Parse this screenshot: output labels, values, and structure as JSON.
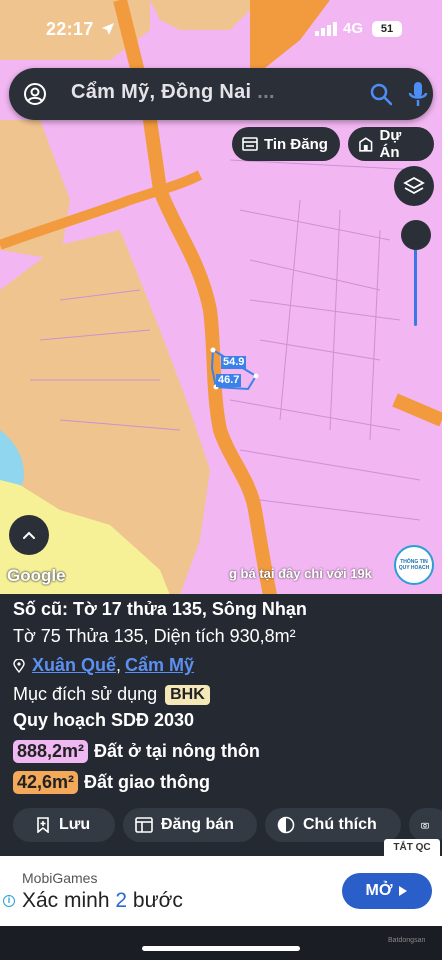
{
  "status": {
    "time": "22:17",
    "network": "4G",
    "battery": "51"
  },
  "search": {
    "text_main": "Cẩm Mỹ, Đồng Nai",
    "text_faded": "..."
  },
  "chips": {
    "tin_dang": "Tin Đăng",
    "du_an": "Dự Án"
  },
  "map": {
    "parcel_label_1": "54.9",
    "parcel_label_2": "46.7",
    "google": "Google",
    "marquee": "g bá tại đây chỉ với 19k",
    "info_badge_line1": "THÔNG TIN",
    "info_badge_line2": "QUY HOẠCH",
    "colors": {
      "residential": "#f2b6f2",
      "agriculture": "#f0c48e",
      "road": "#f29a3e",
      "water": "#8fd6ee",
      "yellow": "#f6f197"
    }
  },
  "sheet": {
    "old_id": "Số cũ: Tờ 17 thửa 135, Sông Nhạn",
    "new_id": "Tờ 75 Thửa 135, Diện tích 930,8m²",
    "commune": "Xuân Quế",
    "district": "Cẩm Mỹ",
    "purpose_label": "Mục đích sử dụng",
    "purpose_code": "BHK",
    "plan_title": "Quy hoạch SDĐ 2030",
    "zones": [
      {
        "area": "888,2m²",
        "label": "Đất ở tại nông thôn",
        "color": "#f0b8f2"
      },
      {
        "area": "42,6m²",
        "label": "Đất giao thông",
        "color": "#f4a85a"
      }
    ]
  },
  "actions": {
    "luu": "Lưu",
    "dang_ban": "Đăng bán",
    "chu_thich": "Chú thích"
  },
  "tat_qc": "TẮT QC",
  "ad": {
    "brand": "MobiGames",
    "title_pre": "Xác minh ",
    "title_num": "2",
    "title_post": " bước",
    "cta": "MỞ"
  },
  "watermark": "Batdongsan"
}
